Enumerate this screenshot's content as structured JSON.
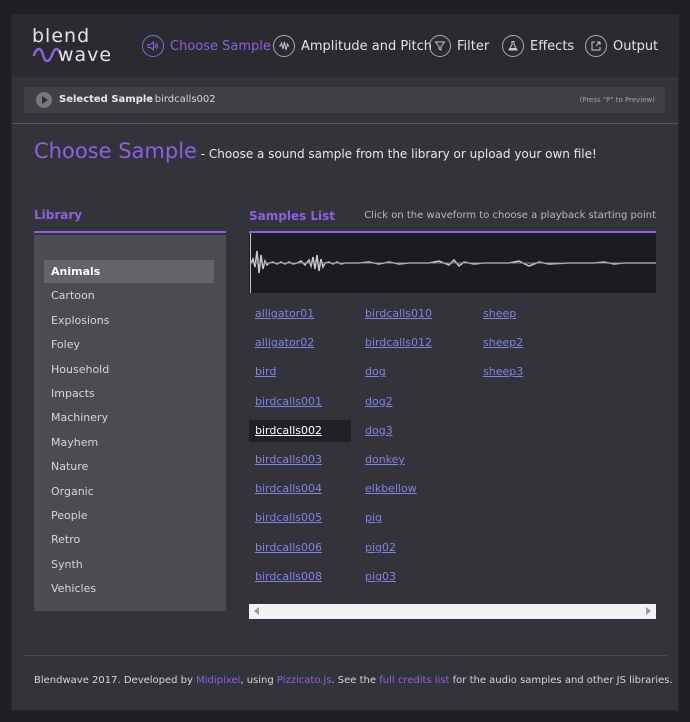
{
  "logo": {
    "top": "blend",
    "bottom": "wave"
  },
  "nav": [
    {
      "label": "Choose Sample",
      "icon": "speaker-icon",
      "active": true
    },
    {
      "label": "Amplitude and Pitch",
      "icon": "waveform-icon",
      "active": false
    },
    {
      "label": "Filter",
      "icon": "funnel-icon",
      "active": false
    },
    {
      "label": "Effects",
      "icon": "flask-icon",
      "active": false
    },
    {
      "label": "Output",
      "icon": "export-icon",
      "active": false
    }
  ],
  "selected": {
    "label": "Selected Sample",
    "separator": " : ",
    "value": "birdcalls002",
    "hint": "(Press \"P\" to Preview)"
  },
  "heading": {
    "title": "Choose Sample",
    "subtitle": " - Choose a sound sample from the library or upload your own file!"
  },
  "library": {
    "title": "Library",
    "items": [
      "Animals",
      "Cartoon",
      "Explosions",
      "Foley",
      "Household",
      "Impacts",
      "Machinery",
      "Mayhem",
      "Nature",
      "Organic",
      "People",
      "Retro",
      "Synth",
      "Vehicles"
    ],
    "active": "Animals"
  },
  "samples": {
    "title": "Samples List",
    "hint": "Click on the waveform to choose a playback starting point",
    "columns": [
      [
        "alligator01",
        "alligator02",
        "bird",
        "birdcalls001",
        "birdcalls002",
        "birdcalls003",
        "birdcalls004",
        "birdcalls005",
        "birdcalls006",
        "birdcalls008"
      ],
      [
        "birdcalls010",
        "birdcalls012",
        "dog",
        "dog2",
        "dog3",
        "donkey",
        "elkbellow",
        "pig",
        "pig02",
        "pig03"
      ],
      [
        "sheep",
        "sheep2",
        "sheep3"
      ]
    ],
    "active": "birdcalls002"
  },
  "footer": {
    "text1": "Blendwave 2017. Developed by ",
    "link1": "Midipixel",
    "text2": ", using ",
    "link2": "Pizzicato.js",
    "text3": ". See the ",
    "link3": "full credits list",
    "text4": " for the audio samples and other JS libraries."
  },
  "colors": {
    "accent": "#8d61e6",
    "link": "#7f83e6",
    "background": "#333439"
  }
}
